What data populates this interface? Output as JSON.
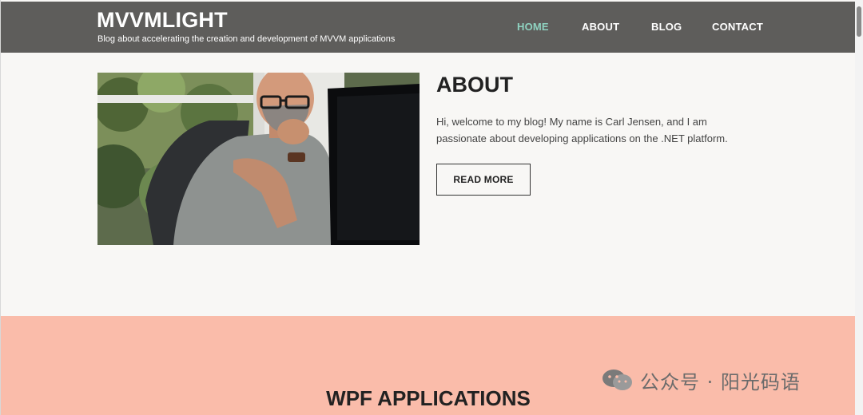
{
  "header": {
    "title": "MVVMLIGHT",
    "tagline": "Blog about accelerating the creation and development of MVVM applications"
  },
  "nav": {
    "items": [
      {
        "label": "HOME",
        "active": true
      },
      {
        "label": "ABOUT",
        "active": false
      },
      {
        "label": "BLOG",
        "active": false
      },
      {
        "label": "CONTACT",
        "active": false
      }
    ]
  },
  "about": {
    "title": "ABOUT",
    "text": "Hi, welcome to my blog! My name is Carl Jensen, and I am passionate about developing applications on the .NET platform.",
    "button_label": "READ MORE",
    "image": "photo of a bald man with glasses and beard at a computer"
  },
  "apps": {
    "title": "WPF APPLICATIONS"
  },
  "watermark": {
    "text": "公众号 · 阳光码语",
    "icon": "wechat-icon"
  },
  "colors": {
    "header_bg": "#5e5d5b",
    "nav_active": "#8fd3c1",
    "page_bg": "#f8f7f5",
    "apps_bg": "#fabcaa"
  }
}
